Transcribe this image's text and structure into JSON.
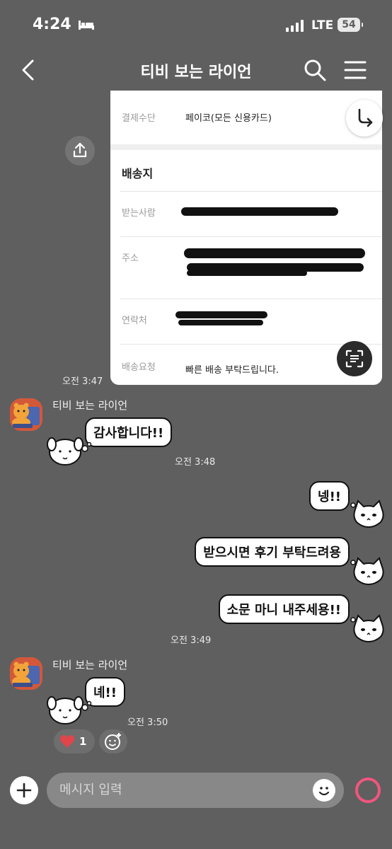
{
  "status_bar": {
    "time": "4:24",
    "network": "LTE",
    "battery": "54"
  },
  "header": {
    "title": "티비 보는 라이언"
  },
  "image_card": {
    "payment_label": "결제수단",
    "payment_value": "페이코(모든 신용카드)",
    "shipping_title": "배송지",
    "recipient_label": "받는사람",
    "address_label": "주소",
    "contact_label": "연락처",
    "request_label": "배송요청",
    "request_value": "빠른 배송 부탁드립니다."
  },
  "messages": [
    {
      "type": "time",
      "text": "오전 3:47"
    },
    {
      "sender": "티비 보는 라이언",
      "text": "감사합니다!!"
    },
    {
      "type": "time",
      "text": "오전 3:48"
    },
    {
      "mine": true,
      "text": "넹!!"
    },
    {
      "mine": true,
      "text": "받으시면 후기 부탁드려용"
    },
    {
      "mine": true,
      "text": "소문 마니 내주세용!!"
    },
    {
      "type": "time",
      "text": "오전 3:49"
    },
    {
      "sender": "티비 보는 라이언",
      "text": "녜!!"
    },
    {
      "type": "time",
      "text": "오전 3:50"
    }
  ],
  "reaction": {
    "icon": "heart-icon",
    "count": "1"
  },
  "input_bar": {
    "placeholder": "메시지 입력"
  },
  "colors": {
    "background": "#5f5f5f",
    "heart": "#e0454a",
    "ring": "#f0567e"
  }
}
